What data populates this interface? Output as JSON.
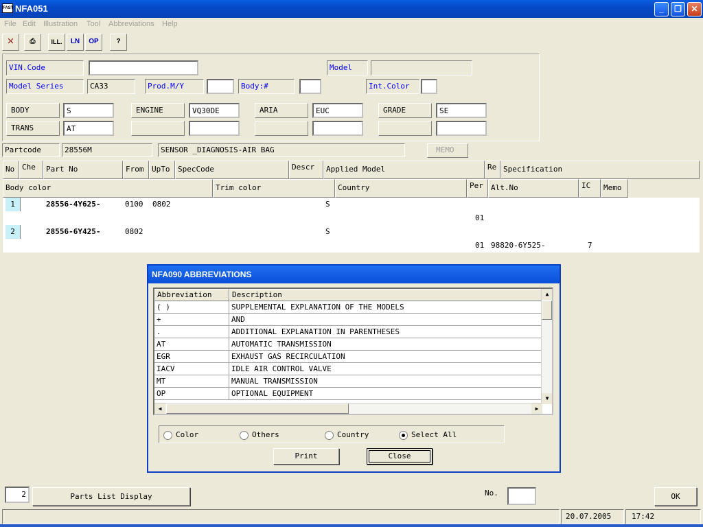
{
  "window": {
    "title": "NFA051",
    "app_icon_text": "FAST"
  },
  "menu": [
    "File",
    "Edit",
    "Illustration",
    "Tool",
    "Abbreviations",
    "Help"
  ],
  "toolbar": [
    {
      "name": "exit-icon",
      "glyph": "⛌"
    },
    {
      "name": "print-icon",
      "glyph": "⎙"
    },
    {
      "name": "illustration-icon",
      "glyph": "ILL."
    },
    {
      "name": "ln-icon",
      "glyph": "LN"
    },
    {
      "name": "op-icon",
      "glyph": "OP"
    },
    {
      "name": "help-icon",
      "glyph": "?"
    }
  ],
  "header": {
    "vin_label": "VIN.Code",
    "vin_value": "",
    "model_label": "Model",
    "model_value": "",
    "model_series_label": "Model Series",
    "model_series_value": "CA33",
    "prod_label": "Prod.M/Y",
    "prod_value": "",
    "body_no_label": "Body:#",
    "body_no_value": "",
    "int_color_label": "Int.Color",
    "int_color_value": "",
    "body_label": "BODY",
    "body_value": "S",
    "engine_label": "ENGINE",
    "engine_value": "VQ30DE",
    "aria_label": "ARIA",
    "aria_value": "EUC",
    "grade_label": "GRADE",
    "grade_value": "SE",
    "trans_label": "TRANS",
    "trans_value": "AT"
  },
  "partcode": {
    "label": "Partcode",
    "code": "28556M",
    "description": "SENSOR _DIAGNOSIS-AIR BAG",
    "memo_button": "MEMO"
  },
  "grid": {
    "headers1": [
      "No",
      "Che",
      "Part No",
      "From",
      "UpTo",
      "SpecCode",
      "Descr",
      "Applied Model",
      "Re",
      "Specification"
    ],
    "headers2": [
      "Body color",
      "Trim color",
      "Country",
      "Per",
      "Alt.No",
      "IC",
      "Memo"
    ],
    "rows": [
      {
        "no": "1",
        "part_no": "28556-4Y625-",
        "from": "0100",
        "upto": "0802",
        "applied": "S",
        "per": "01",
        "alt_no": "",
        "ic": ""
      },
      {
        "no": "2",
        "part_no": "28556-6Y425-",
        "from": "0802",
        "upto": "",
        "applied": "S",
        "per": "01",
        "alt_no": "98820-6Y525-",
        "ic": "7"
      }
    ]
  },
  "dialog": {
    "title": "NFA090 ABBREVIATIONS",
    "col_abbr": "Abbreviation",
    "col_desc": "Description",
    "rows": [
      {
        "abbr": "( )",
        "desc": "SUPPLEMENTAL EXPLANATION OF THE MODELS"
      },
      {
        "abbr": "+",
        "desc": "AND"
      },
      {
        "abbr": ".",
        "desc": "ADDITIONAL EXPLANATION IN PARENTHESES"
      },
      {
        "abbr": "AT",
        "desc": "AUTOMATIC TRANSMISSION"
      },
      {
        "abbr": "EGR",
        "desc": "EXHAUST GAS RECIRCULATION"
      },
      {
        "abbr": "IACV",
        "desc": "IDLE AIR CONTROL VALVE"
      },
      {
        "abbr": "MT",
        "desc": "MANUAL TRANSMISSION"
      },
      {
        "abbr": "OP",
        "desc": "OPTIONAL EQUIPMENT"
      }
    ],
    "radios": [
      "Color",
      "Others",
      "Country",
      "Select All"
    ],
    "selected_radio": "Select All",
    "print_button": "Print",
    "close_button": "Close"
  },
  "bottom": {
    "count_value": "2",
    "parts_list_button": "Parts List Display",
    "no_label": "No.",
    "no_value": "",
    "ok_button": "OK",
    "date": "20.07.2005",
    "time": "17:42"
  }
}
